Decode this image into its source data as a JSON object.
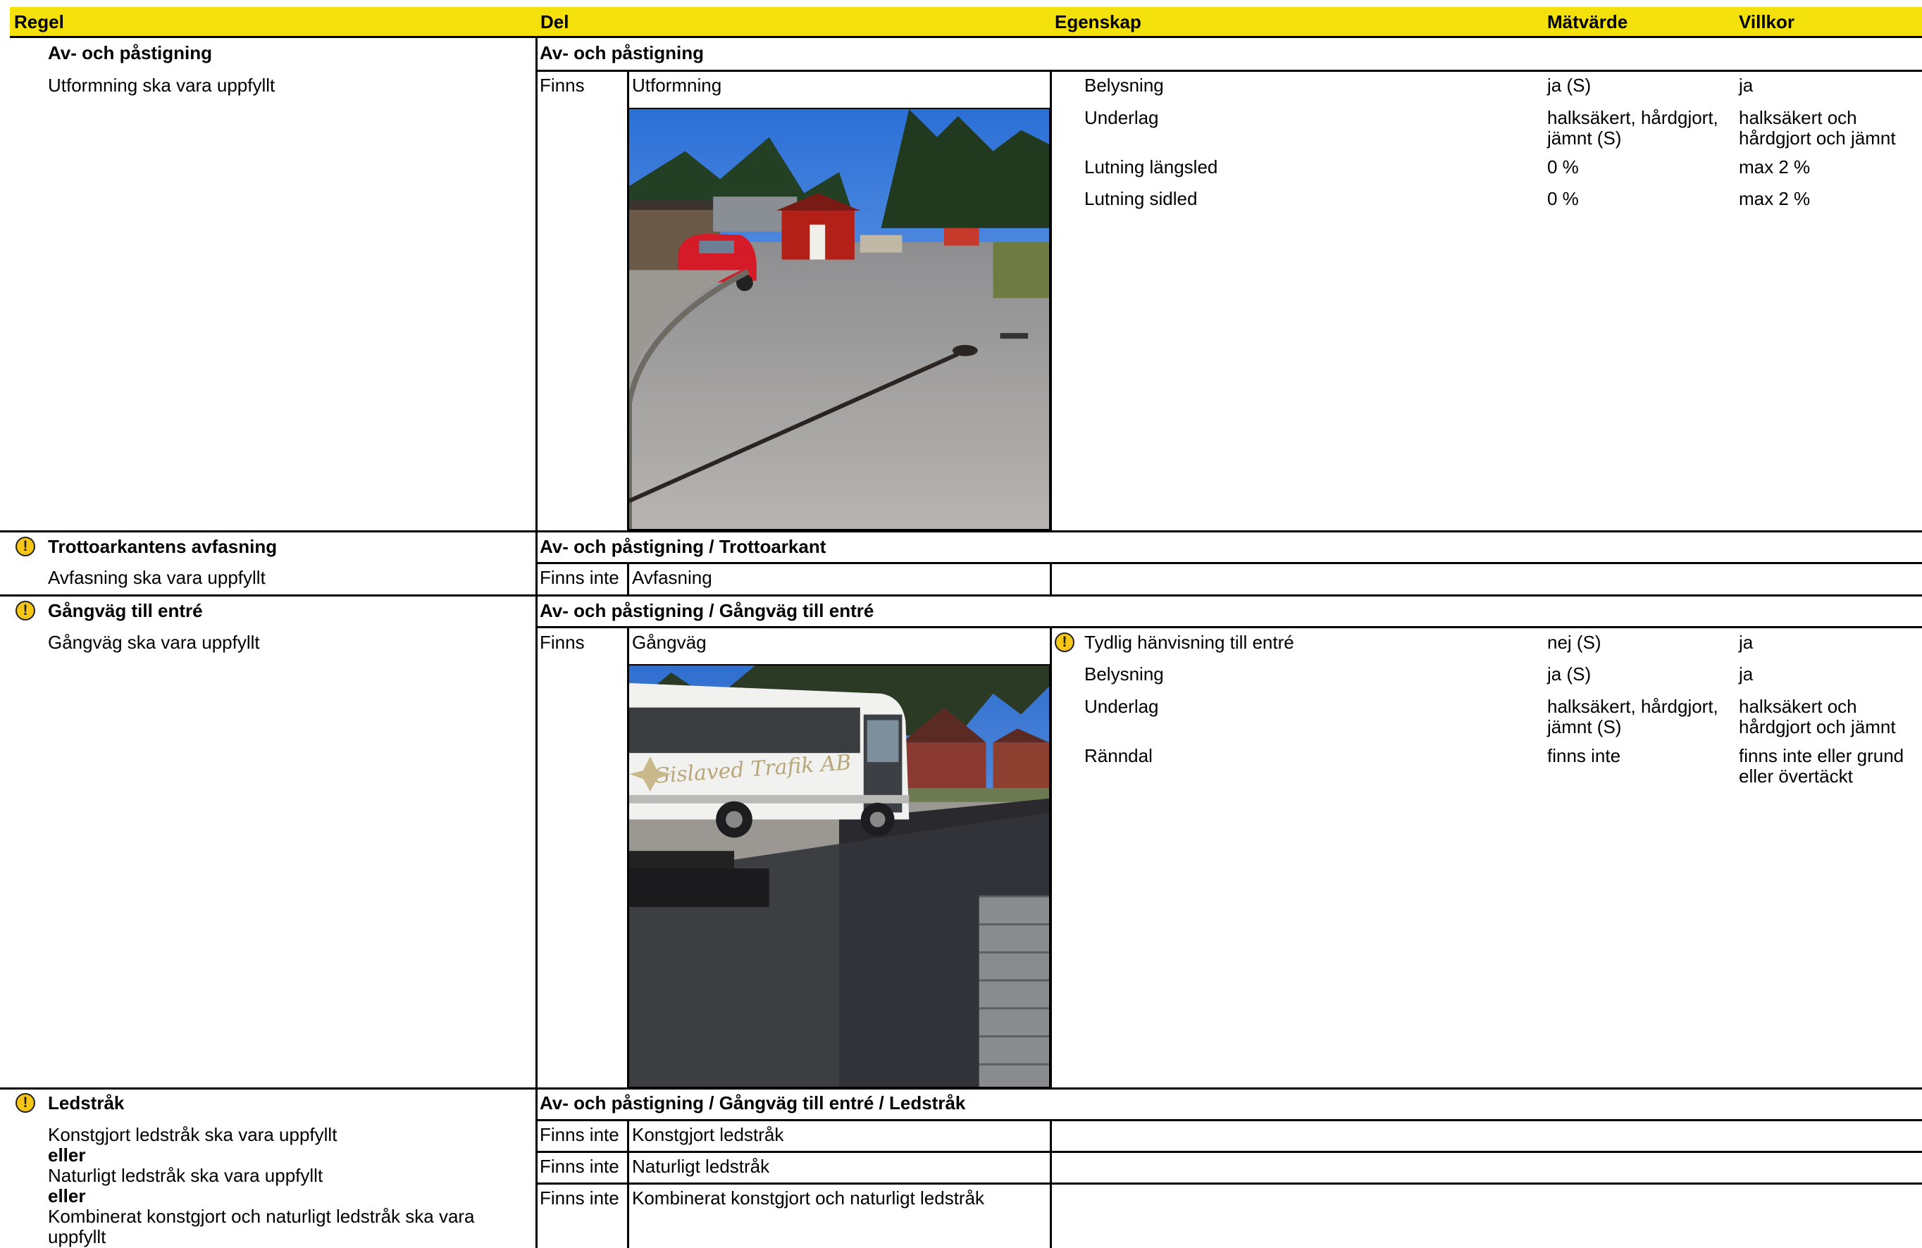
{
  "header": {
    "regel": "Regel",
    "del": "Del",
    "egenskap": "Egenskap",
    "matvarde": "Mätvärde",
    "villkor": "Villkor"
  },
  "sections": [
    {
      "rule_title": "Av- och påstigning",
      "rule_text": "Utformning ska vara uppfyllt",
      "path": "Av- och påstigning",
      "status": "Finns",
      "part": "Utformning",
      "properties": [
        {
          "name": "Belysning",
          "value": "ja (S)",
          "condition": "ja"
        },
        {
          "name": "Underlag",
          "value_l1": "halksäkert, hårdgjort,",
          "value_l2": "jämnt (S)",
          "condition_l1": "halksäkert och",
          "condition_l2": "hårdgjort och jämnt"
        },
        {
          "name": "Lutning längsled",
          "value": "0 %",
          "condition": "max 2 %"
        },
        {
          "name": "Lutning sidled",
          "value": "0 %",
          "condition": "max 2 %"
        }
      ]
    },
    {
      "rule_title": "Trottoarkantens avfasning",
      "rule_text": "Avfasning ska vara uppfyllt",
      "path": "Av- och påstigning / Trottoarkant",
      "status": "Finns inte",
      "part": "Avfasning"
    },
    {
      "rule_title": "Gångväg till entré",
      "rule_text": "Gångväg ska vara uppfyllt",
      "path": "Av- och påstigning / Gångväg till entré",
      "status": "Finns",
      "part": "Gångväg",
      "properties": [
        {
          "name": "Tydlig hänvisning till entré",
          "value": "nej (S)",
          "condition": "ja"
        },
        {
          "name": "Belysning",
          "value": "ja (S)",
          "condition": "ja"
        },
        {
          "name": "Underlag",
          "value_l1": "halksäkert, hårdgjort,",
          "value_l2": "jämnt (S)",
          "condition_l1": "halksäkert och",
          "condition_l2": "hårdgjort och jämnt"
        },
        {
          "name": "Ränndal",
          "value": "finns inte",
          "condition_l1": "finns inte eller grund",
          "condition_l2": "eller övertäckt"
        }
      ]
    },
    {
      "rule_title": "Ledstråk",
      "rule_lines": [
        "Konstgjort ledstråk ska vara uppfyllt",
        "eller",
        "Naturligt ledstråk ska vara uppfyllt",
        "eller",
        "Kombinerat konstgjort och naturligt ledstråk ska vara",
        "uppfyllt"
      ],
      "path": "Av- och påstigning / Gångväg till entré / Ledstråk",
      "rows": [
        {
          "status": "Finns inte",
          "part": "Konstgjort ledstråk"
        },
        {
          "status": "Finns inte",
          "part": "Naturligt ledstråk"
        },
        {
          "status": "Finns inte",
          "part": "Kombinerat konstgjort och naturligt ledstråk"
        }
      ]
    }
  ],
  "photos": [
    {
      "subject": "parking lot with red car and red shed"
    },
    {
      "subject": "white bus with \"Gislaved Trafik AB\" lettering"
    }
  ],
  "bus_lettering": "Gislaved Trafik AB",
  "warning_icon": "!"
}
